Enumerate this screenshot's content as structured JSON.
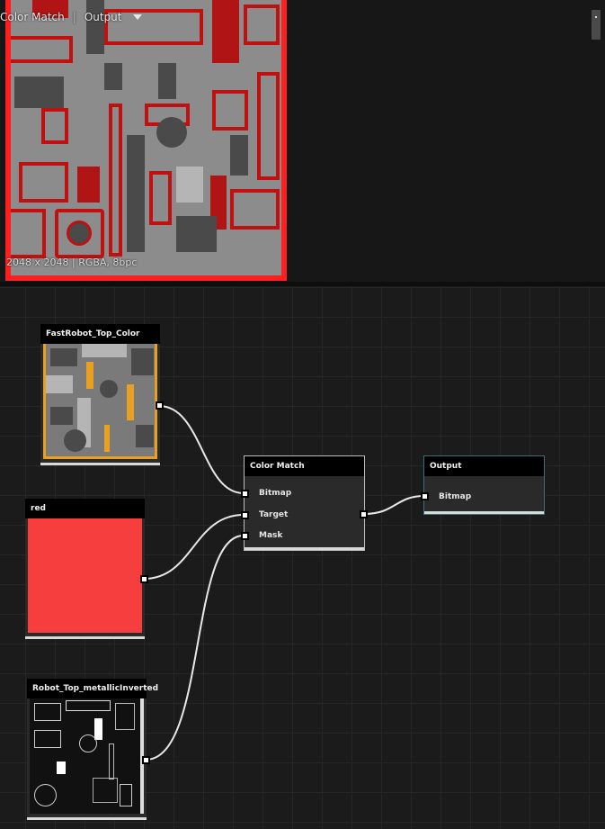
{
  "preview": {
    "node_name": "Color Match",
    "separator": "|",
    "output_label": "Output",
    "info": "2048 x 2048 | RGBA, 8bpc"
  },
  "nodes": {
    "fastrobot": {
      "title": "FastRobot_Top_Color"
    },
    "red": {
      "title": "red",
      "color": "#f73e3e"
    },
    "metallic": {
      "title": "Robot_Top_metallicInverted"
    },
    "color_match": {
      "title": "Color Match",
      "inputs": [
        "Bitmap",
        "Target",
        "Mask"
      ]
    },
    "output": {
      "title": "Output",
      "inputs": [
        "Bitmap"
      ]
    }
  },
  "colors": {
    "preview_tint": "#ff1f1f",
    "texture_accent": "#e8a020",
    "wire": "#e8e8e8",
    "port": "#ffffff"
  }
}
